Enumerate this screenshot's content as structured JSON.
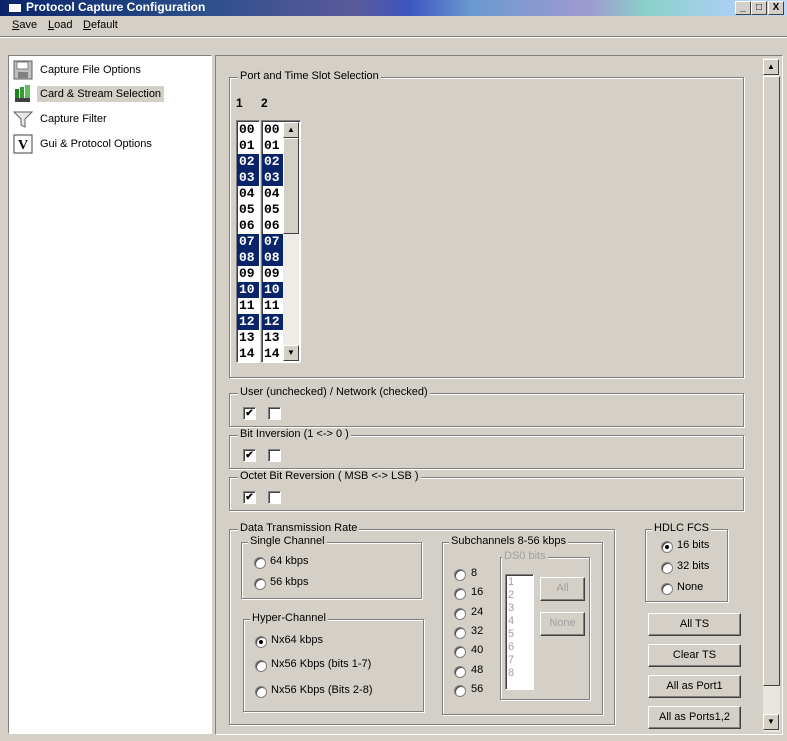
{
  "window": {
    "title": "Protocol Capture Configuration",
    "controls": [
      "_",
      "□",
      "X"
    ]
  },
  "menu": {
    "items": [
      {
        "label": "Save",
        "mnemonic": "S"
      },
      {
        "label": "Load",
        "mnemonic": "L"
      },
      {
        "label": "Default",
        "mnemonic": "D"
      }
    ]
  },
  "nav": {
    "items": [
      {
        "label": "Capture File Options",
        "icon": "floppy-disk-icon",
        "selected": false
      },
      {
        "label": "Card & Stream Selection",
        "icon": "cards-icon",
        "selected": true
      },
      {
        "label": "Capture Filter",
        "icon": "funnel-icon",
        "selected": false
      },
      {
        "label": "Gui & Protocol Options",
        "icon": "v-box-icon",
        "selected": false
      }
    ]
  },
  "port_ts": {
    "title": "Port and Time Slot Selection",
    "port_headers": [
      "1",
      "2"
    ],
    "slots": [
      {
        "label": "00",
        "p1": false,
        "p2": false
      },
      {
        "label": "01",
        "p1": false,
        "p2": false
      },
      {
        "label": "02",
        "p1": true,
        "p2": true
      },
      {
        "label": "03",
        "p1": true,
        "p2": true
      },
      {
        "label": "04",
        "p1": false,
        "p2": false
      },
      {
        "label": "05",
        "p1": false,
        "p2": false
      },
      {
        "label": "06",
        "p1": false,
        "p2": false
      },
      {
        "label": "07",
        "p1": true,
        "p2": true
      },
      {
        "label": "08",
        "p1": true,
        "p2": true
      },
      {
        "label": "09",
        "p1": false,
        "p2": false
      },
      {
        "label": "10",
        "p1": true,
        "p2": true
      },
      {
        "label": "11",
        "p1": false,
        "p2": false
      },
      {
        "label": "12",
        "p1": true,
        "p2": true
      },
      {
        "label": "13",
        "p1": false,
        "p2": false
      },
      {
        "label": "14",
        "p1": false,
        "p2": false
      }
    ]
  },
  "user_network": {
    "title": "User (unchecked) / Network (checked)",
    "port1": true,
    "port2": false
  },
  "bit_inversion": {
    "title": "Bit Inversion (1 <-> 0 )",
    "port1": true,
    "port2": false
  },
  "octet_reversal": {
    "title": "Octet Bit Reversion ( MSB <-> LSB )",
    "port1": true,
    "port2": false
  },
  "rate": {
    "title": "Data Transmission Rate",
    "single": {
      "title": "Single Channel",
      "options": [
        {
          "label": "64 kbps",
          "checked": false
        },
        {
          "label": "56 kbps",
          "checked": false
        }
      ]
    },
    "hyper": {
      "title": "Hyper-Channel",
      "options": [
        {
          "label": "Nx64 kbps",
          "checked": true
        },
        {
          "label": "Nx56 Kbps (bits 1-7)",
          "checked": false
        },
        {
          "label": "Nx56 Kbps (Bits 2-8)",
          "checked": false
        }
      ]
    },
    "sub": {
      "title": "Subchannels 8-56 kbps",
      "options": [
        "8",
        "16",
        "24",
        "32",
        "40",
        "48",
        "56"
      ],
      "ds0_title": "DS0 bits",
      "ds0_bits": [
        "1",
        "2",
        "3",
        "4",
        "5",
        "6",
        "7",
        "8"
      ],
      "all_label": "All",
      "none_label": "None"
    }
  },
  "hdlc": {
    "title": "HDLC FCS",
    "options": [
      {
        "label": "16 bits",
        "checked": true
      },
      {
        "label": "32 bits",
        "checked": false
      },
      {
        "label": "None",
        "checked": false
      }
    ]
  },
  "buttons": {
    "all_ts": "All TS",
    "clear_ts": "Clear TS",
    "all_port1": "All as Port1",
    "all_ports12": "All as Ports1,2"
  },
  "colors": {
    "selection": "#0a246a",
    "face": "#d4d0c8"
  }
}
